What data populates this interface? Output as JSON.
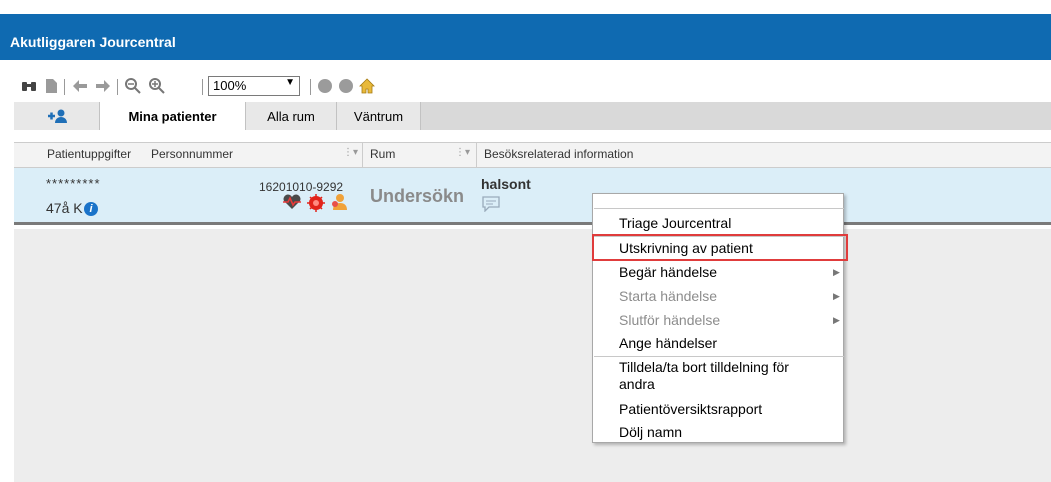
{
  "window": {
    "title": "Akutliggaren Jourcentral"
  },
  "toolbar": {
    "zoom_value": "100%",
    "icons": [
      "binoculars-icon",
      "page-icon",
      "prev-icon",
      "next-icon",
      "zoom-out-icon",
      "zoom-in-icon",
      "circle-icon",
      "circle-icon",
      "home-icon"
    ]
  },
  "tabs": [
    {
      "label": "Mina patienter",
      "active": true
    },
    {
      "label": "Alla rum",
      "active": false
    },
    {
      "label": "Väntrum",
      "active": false
    }
  ],
  "columns": {
    "patient": "Patientuppgifter",
    "personnummer": "Personnummer",
    "room": "Rum",
    "visit_info": "Besöksrelaterad information"
  },
  "row": {
    "name": "*********",
    "age_sex": "47å K",
    "personnummer": "16201010-9292",
    "room": "Undersökn",
    "visit_text": "halsont",
    "icons": [
      "heart-monitor-icon",
      "alert-icon",
      "person-icon",
      "comment-icon",
      "info-icon"
    ]
  },
  "context_menu": {
    "items": [
      {
        "label": "Triage Jourcentral",
        "disabled": false,
        "submenu": false
      },
      {
        "label": "Utskrivning av patient",
        "disabled": false,
        "submenu": false,
        "highlighted": true
      },
      {
        "label": "Begär händelse",
        "disabled": false,
        "submenu": true
      },
      {
        "label": "Starta händelse",
        "disabled": true,
        "submenu": true
      },
      {
        "label": "Slutför händelse",
        "disabled": true,
        "submenu": true
      },
      {
        "label": "Ange händelser",
        "disabled": false,
        "submenu": false
      },
      {
        "label": "Tilldela/ta bort tilldelning för andra",
        "disabled": false,
        "submenu": false
      },
      {
        "label": "Patientöversiktsrapport",
        "disabled": false,
        "submenu": false
      },
      {
        "label": "Dölj namn",
        "disabled": false,
        "submenu": false
      }
    ]
  },
  "colors": {
    "titlebar": "#0f6ab1",
    "row_selected": "#dbeef8",
    "highlight_border": "#e03c3c"
  }
}
